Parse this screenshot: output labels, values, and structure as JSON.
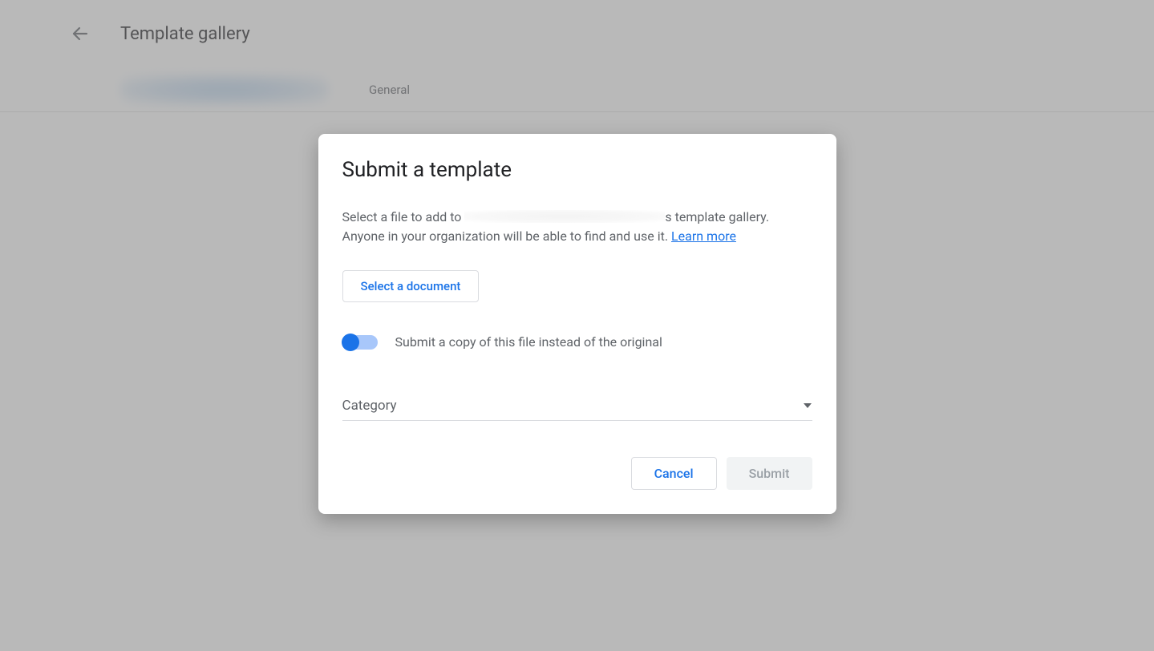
{
  "header": {
    "title": "Template gallery"
  },
  "tabs": {
    "general": "General"
  },
  "modal": {
    "title": "Submit a template",
    "desc_prefix": "Select a file to add to ",
    "desc_suffix": "s template gallery. Anyone in your organization will be able to find and use it. ",
    "learn_more": "Learn more",
    "select_document": "Select a document",
    "toggle_label": "Submit a copy of this file instead of the original",
    "category_label": "Category",
    "cancel": "Cancel",
    "submit": "Submit"
  }
}
